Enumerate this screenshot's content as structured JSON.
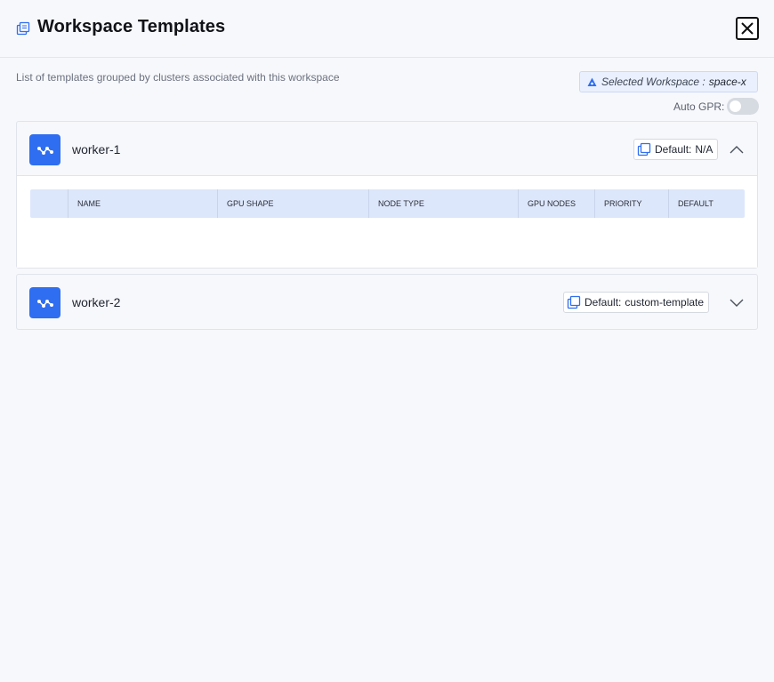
{
  "header": {
    "title": "Workspace Templates",
    "icon": "templates-icon",
    "close_icon": "close-icon"
  },
  "subtitle": "List of templates grouped by clusters associated with this workspace",
  "workspace": {
    "label": "Selected Workspace :",
    "name": "space-x"
  },
  "auto_gpr": {
    "label": "Auto GPR:",
    "enabled": false
  },
  "clusters": [
    {
      "name": "worker-1",
      "default_label": "Default:",
      "default_value": "N/A",
      "expanded": true,
      "table": {
        "columns": [
          "",
          "NAME",
          "GPU SHAPE",
          "NODE TYPE",
          "GPU NODES",
          "PRIORITY",
          "DEFAULT"
        ],
        "rows": []
      }
    },
    {
      "name": "worker-2",
      "default_label": "Default:",
      "default_value": "custom-template",
      "expanded": false
    }
  ],
  "colors": {
    "accent": "#2f6ef0",
    "table_header_bg": "#dde7fb",
    "badge_bg": "#eaf0fd"
  }
}
